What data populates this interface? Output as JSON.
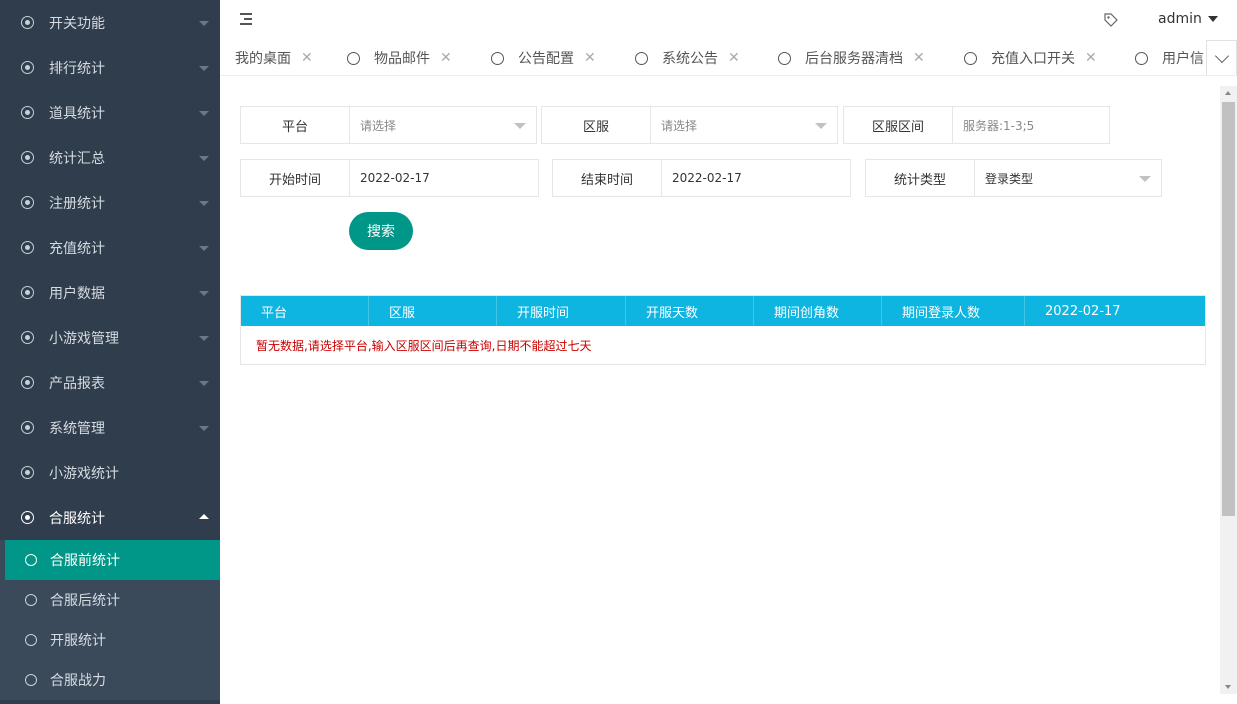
{
  "sidebar": {
    "items": [
      {
        "label": "开关功能"
      },
      {
        "label": "排行统计"
      },
      {
        "label": "道具统计"
      },
      {
        "label": "统计汇总"
      },
      {
        "label": "注册统计"
      },
      {
        "label": "充值统计"
      },
      {
        "label": "用户数据"
      },
      {
        "label": "小游戏管理"
      },
      {
        "label": "产品报表"
      },
      {
        "label": "系统管理"
      },
      {
        "label": "小游戏统计"
      },
      {
        "label": "合服统计"
      }
    ],
    "sub_items": [
      {
        "label": "合服前统计",
        "active": true
      },
      {
        "label": "合服后统计"
      },
      {
        "label": "开服统计"
      },
      {
        "label": "合服战力"
      }
    ]
  },
  "header": {
    "user": "admin"
  },
  "tabs": [
    {
      "label": "我的桌面"
    },
    {
      "label": "物品邮件"
    },
    {
      "label": "公告配置"
    },
    {
      "label": "系统公告"
    },
    {
      "label": "后台服务器清档"
    },
    {
      "label": "充值入口开关"
    },
    {
      "label": "用户信"
    }
  ],
  "form": {
    "platform_label": "平台",
    "platform_placeholder": "请选择",
    "server_label": "区服",
    "server_placeholder": "请选择",
    "range_label": "区服区间",
    "range_placeholder": "服务器:1-3;5",
    "start_label": "开始时间",
    "start_value": "2022-02-17",
    "end_label": "结束时间",
    "end_value": "2022-02-17",
    "type_label": "统计类型",
    "type_value": "登录类型",
    "search_label": "搜索"
  },
  "table": {
    "columns": [
      "平台",
      "区服",
      "开服时间",
      "开服天数",
      "期间创角数",
      "期间登录人数",
      "2022-02-17"
    ],
    "empty_message": "暂无数据,请选择平台,输入区服区间后再查询,日期不能超过七天"
  },
  "colors": {
    "sidebar_bg": "#2f3d4d",
    "accent": "#009688",
    "table_header": "#0eb5e0",
    "error_text": "#cc0000"
  }
}
